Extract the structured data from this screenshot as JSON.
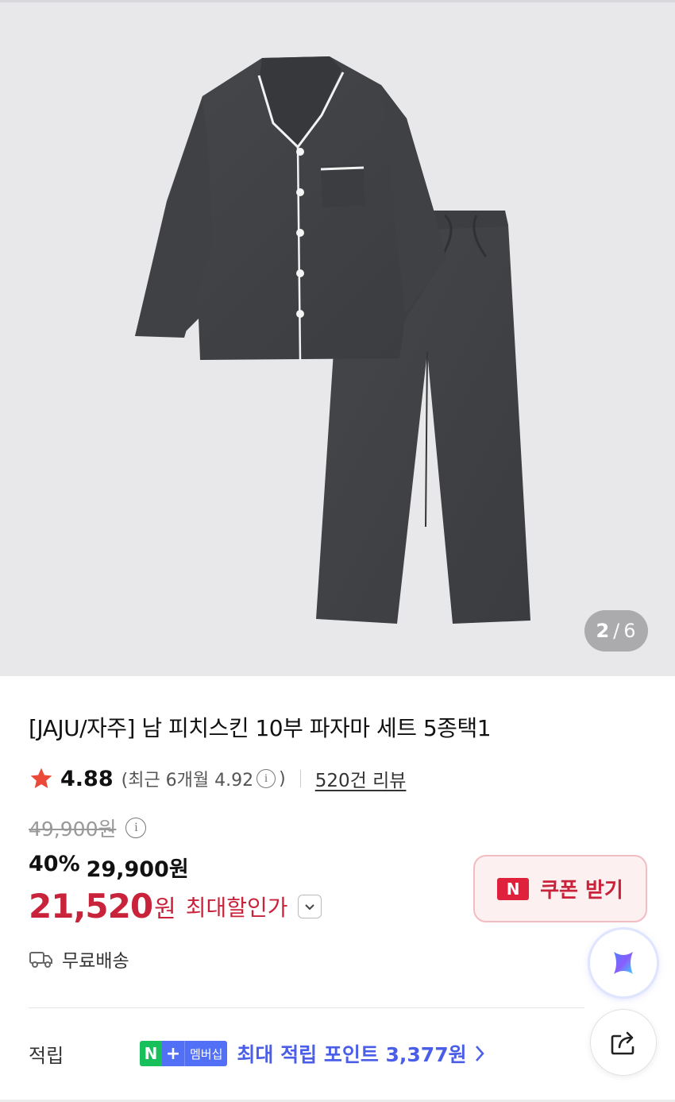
{
  "gallery": {
    "current_index": "2",
    "separator": "/",
    "total": "6",
    "image_icon": "pajama-set-product-image"
  },
  "product": {
    "title": "[JAJU/자주] 남 피치스킨 10부 파자마 세트 5종택1"
  },
  "rating": {
    "value": "4.88",
    "recent_prefix": "(최근 6개월 4.92",
    "recent_suffix": ")",
    "review_link": "520건 리뷰"
  },
  "price": {
    "original": "49,900원",
    "discount_rate": "40%",
    "sale": "29,900원",
    "max_discount_amount": "21,520",
    "max_discount_unit": "원",
    "max_discount_label": "최대할인가"
  },
  "coupon": {
    "badge": "N",
    "label": "쿠폰 받기"
  },
  "shipping": {
    "label": "무료배송",
    "icon": "truck-icon"
  },
  "points": {
    "label": "적립",
    "badge_n": "N",
    "badge_plus": "+",
    "badge_membership": "멤버십",
    "text": "최대 적립 포인트 3,377원"
  },
  "colors": {
    "accent_red": "#c8233b",
    "points_blue": "#4a5ee8",
    "naver_green": "#17c05a",
    "membership_blue": "#5170f5"
  }
}
